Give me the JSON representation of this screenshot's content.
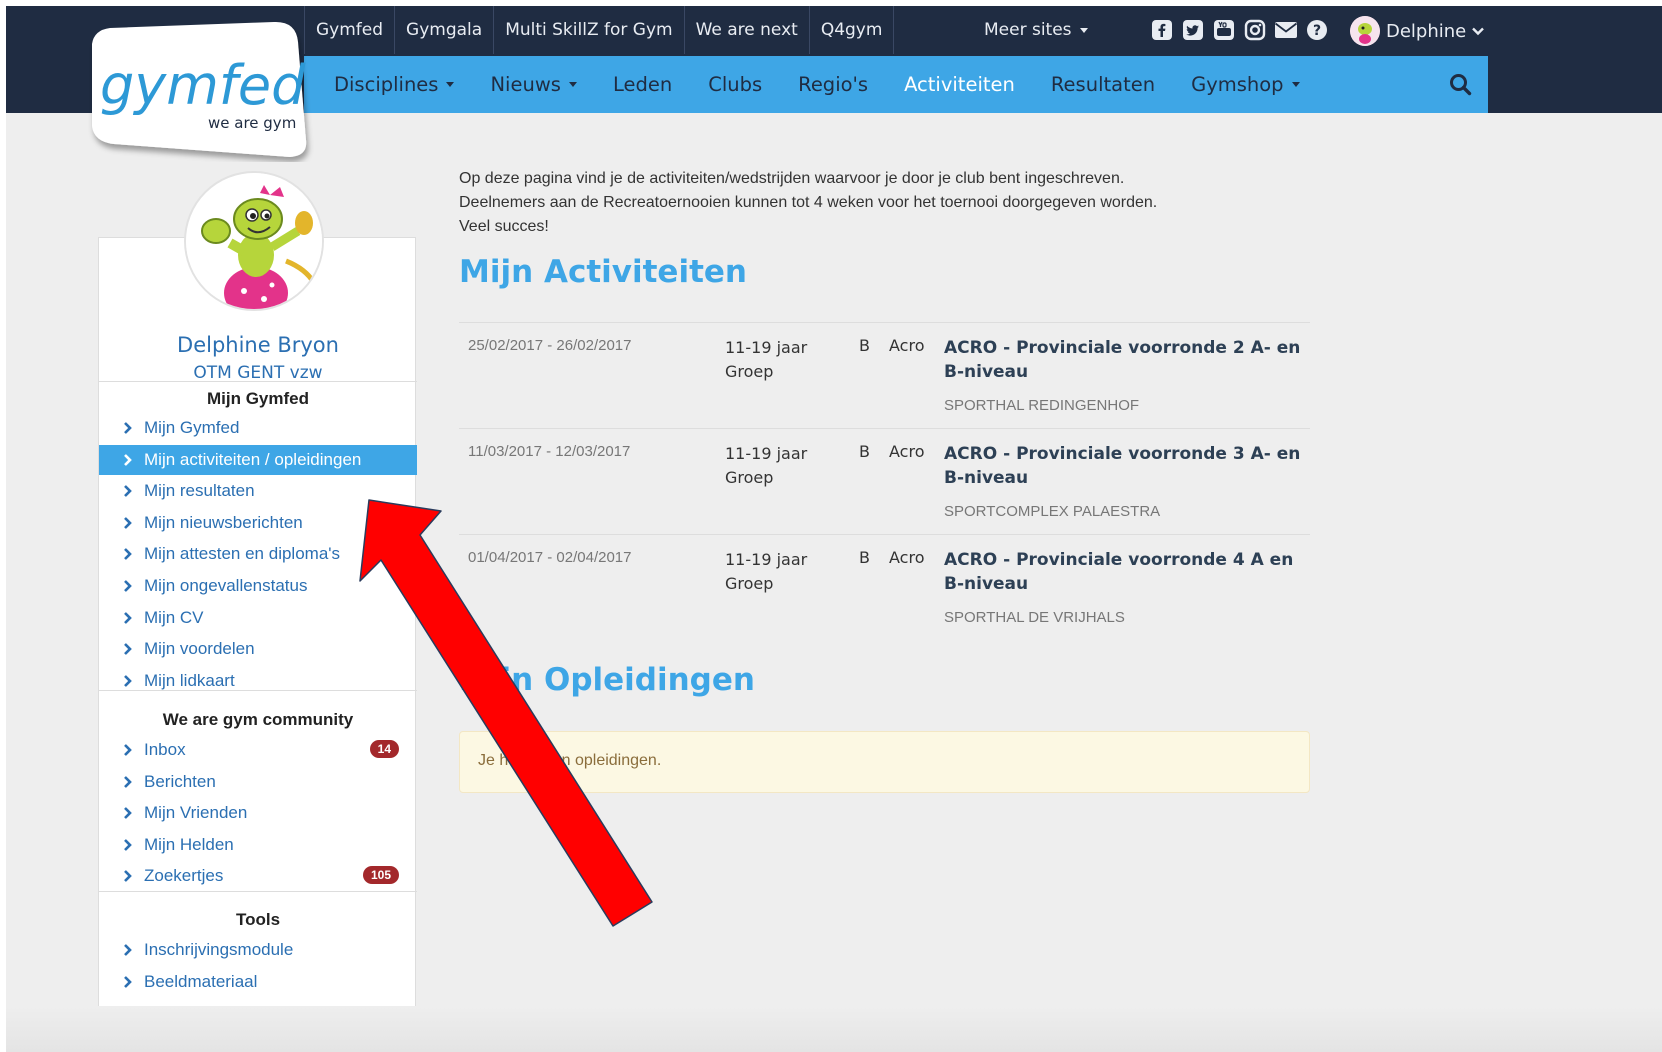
{
  "top_sites": [
    "Gymfed",
    "Gymgala",
    "Multi SkillZ for Gym",
    "We are next",
    "Q4gym"
  ],
  "meer_sites": "Meer sites",
  "user_menu": "Delphine",
  "nav": [
    {
      "label": "Disciplines",
      "caret": true
    },
    {
      "label": "Nieuws",
      "caret": true
    },
    {
      "label": "Leden",
      "caret": false
    },
    {
      "label": "Clubs",
      "caret": false
    },
    {
      "label": "Regio's",
      "caret": false
    },
    {
      "label": "Activiteiten",
      "caret": false,
      "active": true
    },
    {
      "label": "Resultaten",
      "caret": false
    },
    {
      "label": "Gymshop",
      "caret": true
    }
  ],
  "logo": {
    "word": "gymfed",
    "tagline": "we are gym"
  },
  "profile": {
    "name": "Delphine Bryon",
    "club": "OTM GENT vzw"
  },
  "sidebar": {
    "mijn_gymfed_title": "Mijn Gymfed",
    "mijn_gymfed_items": [
      "Mijn Gymfed",
      "Mijn activiteiten / opleidingen",
      "Mijn resultaten",
      "Mijn nieuwsberichten",
      "Mijn attesten en diploma's",
      "Mijn ongevallenstatus",
      "Mijn CV",
      "Mijn voordelen",
      "Mijn lidkaart"
    ],
    "community_title": "We are gym community",
    "community_items": [
      {
        "label": "Inbox",
        "badge": "14"
      },
      {
        "label": "Berichten",
        "badge": ""
      },
      {
        "label": "Mijn Vrienden",
        "badge": ""
      },
      {
        "label": "Mijn Helden",
        "badge": ""
      },
      {
        "label": "Zoekertjes",
        "badge": "105"
      }
    ],
    "tools_title": "Tools",
    "tools_items": [
      "Inschrijvingsmodule",
      "Beeldmateriaal"
    ]
  },
  "intro": [
    "Op deze pagina vind je de activiteiten/wedstrijden waarvoor je door je club bent ingeschreven.",
    "Deelnemers aan de Recreatoernooien kunnen tot 4 weken voor het toernooi doorgegeven worden.",
    "Veel succes!"
  ],
  "headings": {
    "activiteiten": "Mijn Activiteiten",
    "opleidingen": "Mijn Opleidingen"
  },
  "activities": [
    {
      "date": "25/02/2017 - 26/02/2017",
      "age": "11-19 jaar",
      "group": "Groep",
      "level": "B",
      "discipline": "Acro",
      "title": "ACRO - Provinciale voorronde 2 A- en B-niveau",
      "venue": "SPORTHAL REDINGENHOF"
    },
    {
      "date": "11/03/2017 - 12/03/2017",
      "age": "11-19 jaar",
      "group": "Groep",
      "level": "B",
      "discipline": "Acro",
      "title": "ACRO - Provinciale voorronde 3 A- en B-niveau",
      "venue": "SPORTCOMPLEX PALAESTRA"
    },
    {
      "date": "01/04/2017 - 02/04/2017",
      "age": "11-19 jaar",
      "group": "Groep",
      "level": "B",
      "discipline": "Acro",
      "title": "ACRO - Provinciale voorronde 4 A en B-niveau",
      "venue": "SPORTHAL DE VRIJHALS"
    }
  ],
  "notice": "Je hebt geen opleidingen.",
  "colors": {
    "nav_bg": "#1f2c42",
    "accent": "#3ea6e6",
    "link": "#2b6fb2",
    "badge": "#a3282b",
    "arrow": "#ff0000"
  }
}
